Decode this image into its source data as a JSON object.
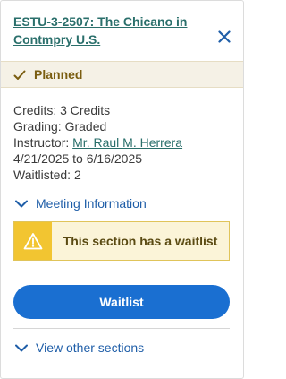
{
  "header": {
    "title": "ESTU-3-2507: The Chicano in Contmpry U.S.",
    "close_icon": "close-icon"
  },
  "status": {
    "label": "Planned",
    "icon": "checkmark-icon",
    "color": "#7a5d10"
  },
  "details": {
    "credits": "Credits: 3 Credits",
    "grading": "Grading: Graded",
    "instructor_label": "Instructor: ",
    "instructor_name": "Mr. Raul M. Herrera",
    "dates": "4/21/2025 to 6/16/2025",
    "waitlisted": "Waitlisted:  2"
  },
  "meeting": {
    "label": "Meeting Information",
    "icon": "chevron-down-icon"
  },
  "warning": {
    "message": "This section has a waitlist",
    "icon": "warning-icon",
    "color": "#f2c531"
  },
  "actions": {
    "primary_label": "Waitlist",
    "primary_color": "#1a6fd1"
  },
  "other_sections": {
    "label": "View other sections",
    "icon": "chevron-down-icon"
  }
}
